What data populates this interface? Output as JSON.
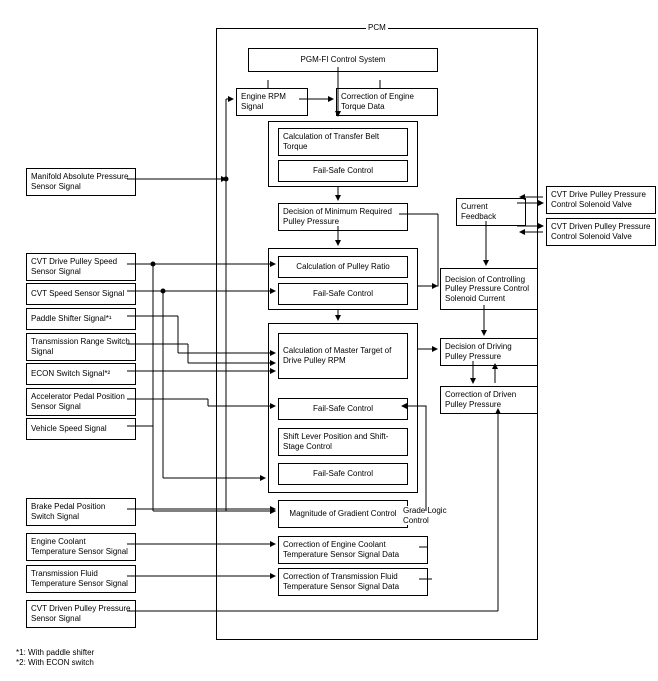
{
  "pcm_label": "PCM",
  "left_inputs": {
    "manifold": "Manifold Absolute Pressure Sensor Signal",
    "drive_pulley_speed": "CVT Drive Pulley Speed Sensor Signal",
    "cvt_speed": "CVT Speed Sensor Signal",
    "paddle_shifter": "Paddle Shifter Signal*¹",
    "trans_range": "Transmission Range Switch Signal",
    "econ": "ECON Switch Signal*²",
    "accel_pedal": "Accelerator Pedal Position Sensor Signal",
    "vehicle_speed": "Vehicle Speed Signal",
    "brake_pedal": "Brake Pedal Position Switch Signal",
    "coolant_temp": "Engine Coolant Temperature Sensor Signal",
    "trans_fluid_temp": "Transmission Fluid Temperature Sensor Signal",
    "driven_pulley_press": "CVT Driven Pulley Pressure Sensor Signal"
  },
  "center": {
    "pgm_fi": "PGM-FI Control System",
    "engine_rpm": "Engine RPM Signal",
    "torque_correction": "Correction of Engine Torque Data",
    "calc_belt_torque": "Calculation of Transfer Belt Torque",
    "failsafe1": "Fail-Safe Control",
    "min_pulley_press": "Decision of Minimum Required Pulley Pressure",
    "calc_pulley_ratio": "Calculation of Pulley Ratio",
    "failsafe2": "Fail-Safe Control",
    "calc_master_target": "Calculation of Master Target of Drive Pulley RPM",
    "failsafe3": "Fail-Safe Control",
    "shift_lever": "Shift Lever Position and Shift-Stage Control",
    "failsafe4": "Fail-Safe Control",
    "gradient": "Magnitude of Gradient Control",
    "grade_logic_label": "Grade Logic Control",
    "coolant_correction": "Correction of Engine Coolant Temperature Sensor Signal Data",
    "fluid_correction": "Correction of Transmission Fluid Temperature Sensor Signal Data"
  },
  "right_inner": {
    "current_feedback": "Current Feedback",
    "solenoid_current": "Decision of Controlling Pulley Pressure Control Solenoid Current",
    "driving_pulley": "Decision of Driving Pulley Pressure",
    "driven_correction": "Correction of Driven Pulley Pressure"
  },
  "right_outputs": {
    "drive_solenoid": "CVT Drive Pulley Pressure Control Solenoid Valve",
    "driven_solenoid": "CVT Driven Pulley Pressure Control Solenoid Valve"
  },
  "footnotes": {
    "f1": "*1: With paddle shifter",
    "f2": "*2: With ECON switch"
  }
}
